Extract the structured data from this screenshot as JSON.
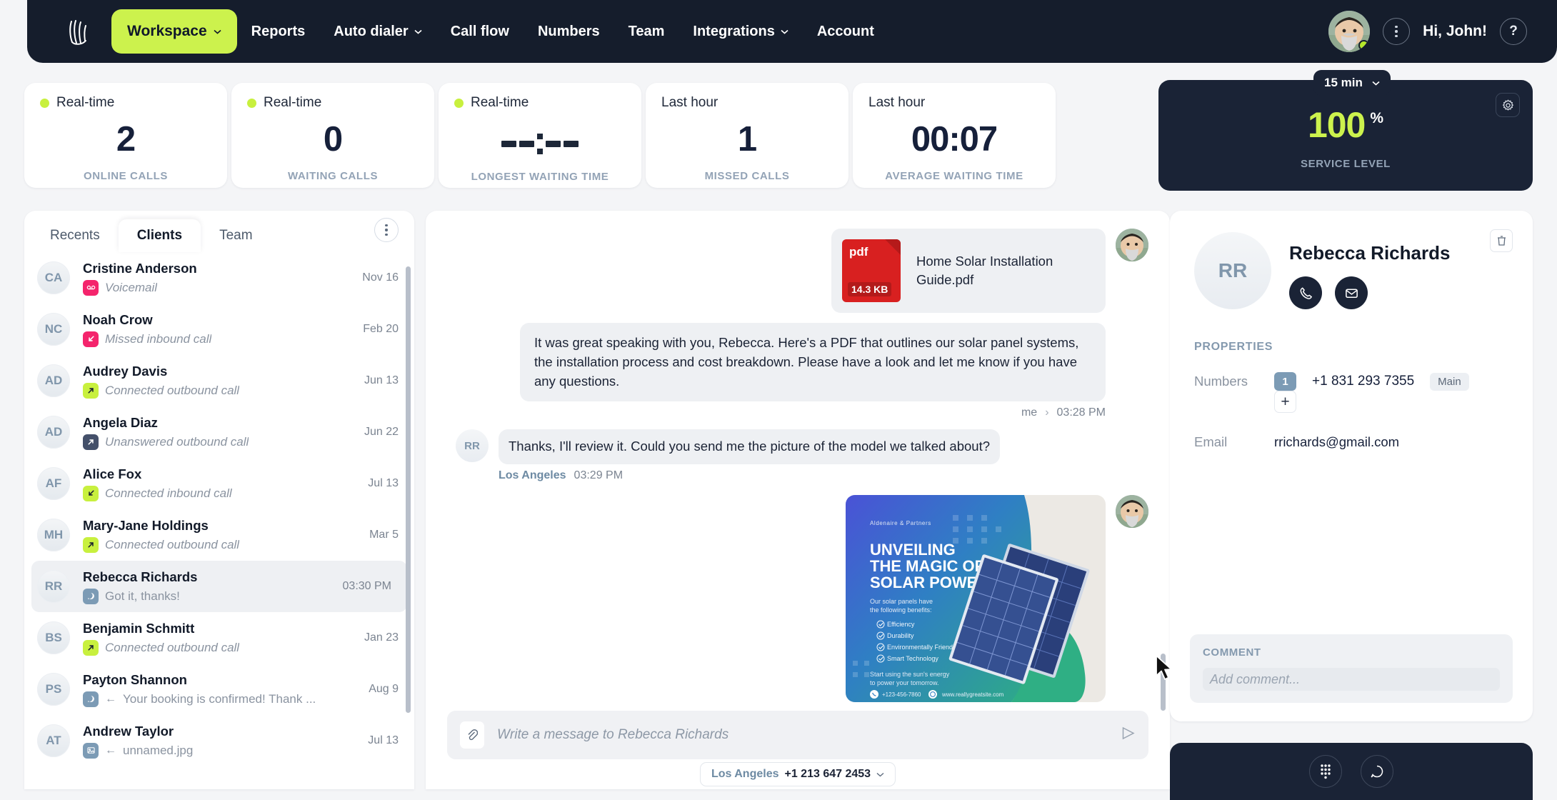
{
  "nav": {
    "logo_icon": "hand-logo-icon",
    "workspace": {
      "label": "Workspace",
      "icon": "chevron-down-icon"
    },
    "items": [
      {
        "label": "Reports",
        "caret": false
      },
      {
        "label": "Auto dialer",
        "caret": true
      },
      {
        "label": "Call flow",
        "caret": false
      },
      {
        "label": "Numbers",
        "caret": false
      },
      {
        "label": "Team",
        "caret": false
      },
      {
        "label": "Integrations",
        "caret": true
      },
      {
        "label": "Account",
        "caret": false
      }
    ],
    "greeting": "Hi, John!",
    "help_icon": "question-mark-icon",
    "kebab_icon": "kebab-menu-icon",
    "avatar_icon": "user-avatar-photo",
    "accent": "#ccf24d"
  },
  "stats": {
    "cards": [
      {
        "period": "Real-time",
        "realtime": true,
        "value": "2",
        "caption": "ONLINE CALLS"
      },
      {
        "period": "Real-time",
        "realtime": true,
        "value": "0",
        "caption": "WAITING CALLS"
      },
      {
        "period": "Real-time",
        "realtime": true,
        "value": "--:--",
        "caption": "LONGEST WAITING TIME"
      },
      {
        "period": "Last hour",
        "realtime": false,
        "value": "1",
        "caption": "MISSED CALLS"
      },
      {
        "period": "Last hour",
        "realtime": false,
        "value": "00:07",
        "caption": "AVERAGE WAITING TIME"
      }
    ],
    "service_level": {
      "range": "15 min",
      "range_icon": "chevron-down-icon",
      "gear_icon": "gear-icon",
      "value": "100",
      "unit": "%",
      "caption": "SERVICE LEVEL",
      "value_color": "#ccf24d"
    }
  },
  "contacts": {
    "tabs": [
      {
        "label": "Recents",
        "active": false
      },
      {
        "label": "Clients",
        "active": true
      },
      {
        "label": "Team",
        "active": false
      }
    ],
    "menu_icon": "kebab-menu-icon",
    "items": [
      {
        "initials": "CA",
        "name": "Cristine Anderson",
        "icon": "voicemail-icon",
        "icon_color": "pink",
        "desc": "Voicemail",
        "italic": true,
        "arrow": false,
        "date": "Nov 16",
        "selected": false
      },
      {
        "initials": "NC",
        "name": "Noah Crow",
        "icon": "missed-inbound-icon",
        "icon_color": "pink",
        "desc": "Missed inbound call",
        "italic": true,
        "arrow": false,
        "date": "Feb 20",
        "selected": false
      },
      {
        "initials": "AD",
        "name": "Audrey Davis",
        "icon": "outbound-call-icon",
        "icon_color": "green",
        "desc": "Connected outbound call",
        "italic": true,
        "arrow": false,
        "date": "Jun 13",
        "selected": false
      },
      {
        "initials": "AD",
        "name": "Angela Diaz",
        "icon": "outbound-call-icon",
        "icon_color": "dark",
        "desc": "Unanswered outbound call",
        "italic": true,
        "arrow": false,
        "date": "Jun 22",
        "selected": false
      },
      {
        "initials": "AF",
        "name": "Alice Fox",
        "icon": "inbound-call-icon",
        "icon_color": "green",
        "desc": "Connected inbound call",
        "italic": true,
        "arrow": false,
        "date": "Jul 13",
        "selected": false
      },
      {
        "initials": "MH",
        "name": "Mary-Jane Holdings",
        "icon": "outbound-call-icon",
        "icon_color": "green",
        "desc": "Connected outbound call",
        "italic": true,
        "arrow": false,
        "date": "Mar 5",
        "selected": false
      },
      {
        "initials": "RR",
        "name": "Rebecca Richards",
        "icon": "message-icon",
        "icon_color": "blue",
        "desc": "Got it, thanks!",
        "italic": false,
        "arrow": false,
        "date": "03:30 PM",
        "selected": true
      },
      {
        "initials": "BS",
        "name": "Benjamin Schmitt",
        "icon": "outbound-call-icon",
        "icon_color": "green",
        "desc": "Connected outbound call",
        "italic": true,
        "arrow": false,
        "date": "Jan 23",
        "selected": false
      },
      {
        "initials": "PS",
        "name": "Payton Shannon",
        "icon": "message-icon",
        "icon_color": "blue",
        "desc": "Your booking is confirmed! Thank ...",
        "italic": false,
        "arrow": true,
        "date": "Aug 9",
        "selected": false
      },
      {
        "initials": "AT",
        "name": "Andrew Taylor",
        "icon": "image-attachment-icon",
        "icon_color": "blue",
        "desc": "unnamed.jpg",
        "italic": false,
        "arrow": true,
        "date": "Jul 13",
        "selected": false
      }
    ]
  },
  "chat": {
    "messages": [
      {
        "direction": "out",
        "type": "file",
        "file_name": "Home Solar Installation Guide.pdf",
        "file_kind": "pdf",
        "file_size": "14.3 KB"
      },
      {
        "direction": "out",
        "type": "text",
        "text": "It was great speaking with you, Rebecca. Here's a PDF that outlines our solar panel systems, the installation process and cost breakdown. Please have a look and let me know if you have any questions.",
        "author": "me",
        "time": "03:28 PM"
      },
      {
        "direction": "in",
        "type": "text",
        "text": "Thanks, I'll review it. Could you send me the picture of the model we talked about?",
        "author": "Los Angeles",
        "time": "03:29 PM",
        "initials": "RR"
      },
      {
        "direction": "out",
        "type": "image",
        "image_alt": "solar-panel-flyer",
        "image_brand": "Aldenaire & Partners",
        "image_title": "UNVEILING THE MAGIC OF SOLAR POWER",
        "image_sub": "Our solar panels have the following benefits:",
        "image_bullets": [
          "Efficiency",
          "Durability",
          "Environmentally Friendly",
          "Smart Technology"
        ],
        "image_footer": "Start using the sun's energy to power your tomorrow.",
        "image_phone": "+123-456-7860",
        "image_site": "www.reallygreatsite.com"
      }
    ],
    "composer": {
      "placeholder": "Write a message to Rebecca Richards",
      "attach_icon": "paperclip-icon",
      "send_icon": "send-icon",
      "from_city": "Los Angeles",
      "from_number": "+1 213 647 2453",
      "from_caret": "chevron-down-icon"
    }
  },
  "details": {
    "initials": "RR",
    "name": "Rebecca Richards",
    "call_icon": "phone-icon",
    "mail_icon": "envelope-icon",
    "delete_icon": "trash-icon",
    "properties_title": "PROPERTIES",
    "numbers_label": "Numbers",
    "number_badge": "1",
    "number": "+1 831 293 7355",
    "number_tag": "Main",
    "add_number_icon": "plus-icon",
    "email_label": "Email",
    "email": "rrichards@gmail.com",
    "comment_title": "COMMENT",
    "comment_placeholder": "Add comment..."
  },
  "dock": {
    "dialpad_icon": "dialpad-icon",
    "chat_icon": "chat-bubble-icon"
  }
}
